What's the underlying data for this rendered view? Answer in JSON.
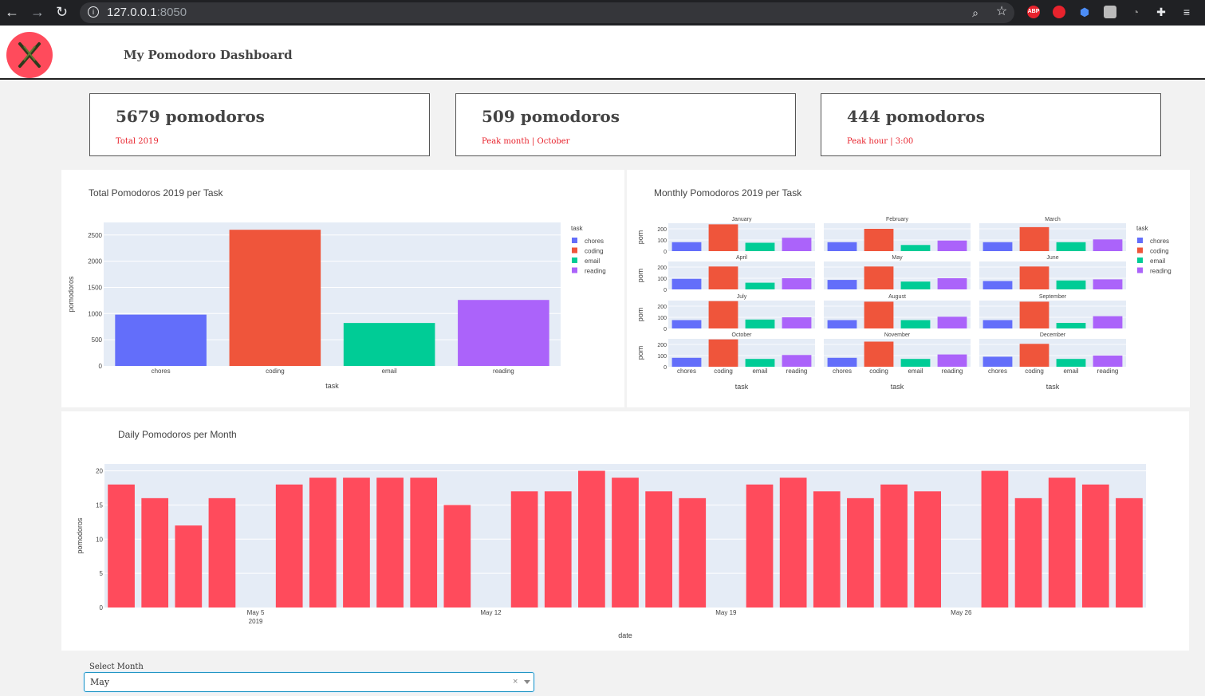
{
  "browser": {
    "url_host": "127.0.0.1",
    "url_port": ":8050",
    "extensions": [
      "zoom-icon",
      "star-icon",
      "adblock-icon",
      "stop-icon",
      "shield-icon",
      "square-icon",
      "c-icon",
      "puzzle-icon",
      "menu-icon"
    ]
  },
  "header": {
    "title": "My Pomodoro Dashboard"
  },
  "kpis": [
    {
      "value": "5679 pomodoros",
      "label": "Total 2019"
    },
    {
      "value": "509 pomodoros",
      "label": "Peak month | October"
    },
    {
      "value": "444 pomodoros",
      "label": "Peak hour | 3:00"
    }
  ],
  "colors": {
    "chores": "#636efa",
    "coding": "#ef553b",
    "email": "#00cc96",
    "reading": "#ab63fa",
    "daily": "#ff4b5c",
    "plot_bg": "#e5ecf6"
  },
  "chart_data": [
    {
      "type": "bar",
      "title": "Total Pomodoros 2019 per Task",
      "categories": [
        "chores",
        "coding",
        "email",
        "reading"
      ],
      "values": [
        980,
        2600,
        820,
        1260
      ],
      "xlabel": "task",
      "ylabel": "pomodoros",
      "yticks": [
        0,
        500,
        1000,
        1500,
        2000,
        2500
      ],
      "ylim": [
        0,
        2740
      ],
      "legend": {
        "title": "task",
        "entries": [
          "chores",
          "coding",
          "email",
          "reading"
        ],
        "position": "right"
      }
    },
    {
      "type": "bar",
      "title": "Monthly Pomodoros 2019 per Task",
      "categories": [
        "chores",
        "coding",
        "email",
        "reading"
      ],
      "xlabel": "task",
      "ylabel": "pom",
      "yticks": [
        0,
        100,
        200
      ],
      "ylim": [
        0,
        250
      ],
      "panels": [
        {
          "name": "January",
          "values": [
            80,
            240,
            75,
            120
          ]
        },
        {
          "name": "February",
          "values": [
            80,
            200,
            55,
            95
          ]
        },
        {
          "name": "March",
          "values": [
            80,
            215,
            80,
            105
          ]
        },
        {
          "name": "April",
          "values": [
            95,
            205,
            60,
            100
          ]
        },
        {
          "name": "May",
          "values": [
            85,
            205,
            70,
            100
          ]
        },
        {
          "name": "June",
          "values": [
            75,
            205,
            80,
            90
          ]
        },
        {
          "name": "July",
          "values": [
            75,
            245,
            80,
            100
          ]
        },
        {
          "name": "August",
          "values": [
            75,
            240,
            75,
            105
          ]
        },
        {
          "name": "September",
          "values": [
            75,
            240,
            50,
            110
          ]
        },
        {
          "name": "October",
          "values": [
            80,
            245,
            70,
            105
          ]
        },
        {
          "name": "November",
          "values": [
            80,
            225,
            70,
            110
          ]
        },
        {
          "name": "December",
          "values": [
            90,
            205,
            70,
            100
          ]
        }
      ],
      "legend": {
        "title": "task",
        "entries": [
          "chores",
          "coding",
          "email",
          "reading"
        ],
        "position": "right"
      }
    },
    {
      "type": "bar",
      "title": "Daily Pomodoros per Month",
      "x": [
        "2019-05-01",
        "2019-05-02",
        "2019-05-03",
        "2019-05-04",
        "2019-05-05",
        "2019-05-06",
        "2019-05-07",
        "2019-05-08",
        "2019-05-09",
        "2019-05-10",
        "2019-05-11",
        "2019-05-12",
        "2019-05-13",
        "2019-05-14",
        "2019-05-15",
        "2019-05-16",
        "2019-05-17",
        "2019-05-18",
        "2019-05-19",
        "2019-05-20",
        "2019-05-21",
        "2019-05-22",
        "2019-05-23",
        "2019-05-24",
        "2019-05-25",
        "2019-05-26",
        "2019-05-27",
        "2019-05-28",
        "2019-05-29",
        "2019-05-30",
        "2019-05-31"
      ],
      "values": [
        18,
        16,
        12,
        16,
        null,
        18,
        19,
        19,
        19,
        19,
        15,
        null,
        17,
        17,
        20,
        19,
        17,
        16,
        null,
        18,
        19,
        17,
        16,
        18,
        17,
        null,
        20,
        16,
        19,
        18,
        16
      ],
      "xticks": [
        "May 5\n2019",
        "May 12",
        "May 19",
        "May 26"
      ],
      "xlabel": "date",
      "ylabel": "pomodoros",
      "yticks": [
        0,
        5,
        10,
        15,
        20
      ],
      "ylim": [
        0,
        21
      ]
    }
  ],
  "month_select": {
    "label": "Select Month",
    "value": "May",
    "clear": "×"
  }
}
